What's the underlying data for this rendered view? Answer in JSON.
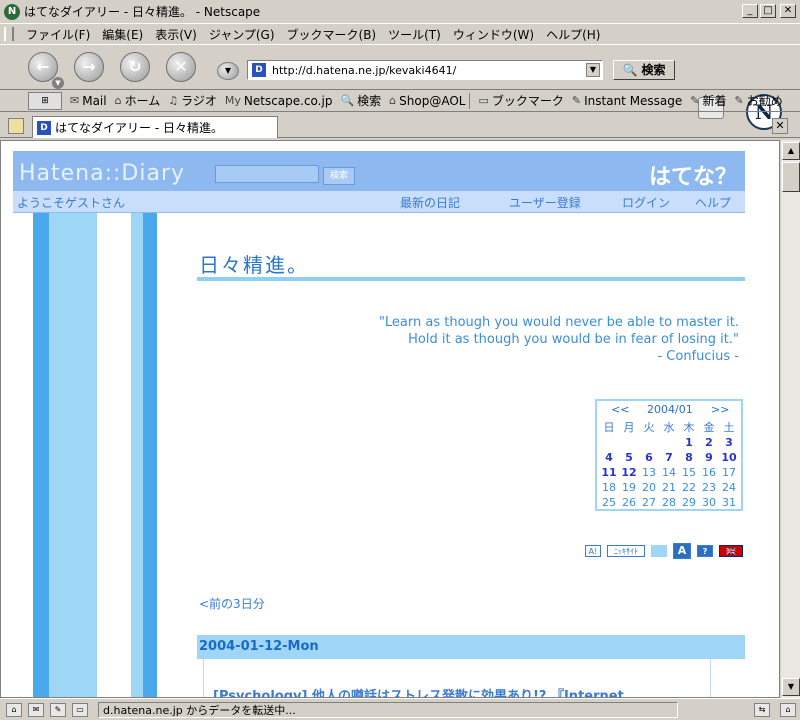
{
  "window": {
    "title": "はてなダイアリー - 日々精進。 - Netscape",
    "app_icon": "N",
    "minimize": "_",
    "maximize": "□",
    "close": "✕"
  },
  "menu": [
    "ファイル(F)",
    "編集(E)",
    "表示(V)",
    "ジャンプ(G)",
    "ブックマーク(B)",
    "ツール(T)",
    "ウィンドウ(W)",
    "ヘルプ(H)"
  ],
  "nav": {
    "url": "http://d.hatena.ne.jp/kevaki4641/",
    "search_label": "🔍 検索",
    "logo_letter": "N"
  },
  "personal_toolbar": [
    {
      "icon": "✉",
      "label": "Mail"
    },
    {
      "icon": "⌂",
      "label": "ホーム"
    },
    {
      "icon": "♫",
      "label": "ラジオ"
    },
    {
      "icon": "My",
      "label": "Netscape.co.jp"
    },
    {
      "icon": "🔍",
      "label": "検索"
    },
    {
      "icon": "⌂",
      "label": "Shop@AOL"
    },
    {
      "icon": "▭",
      "label": "ブックマーク"
    },
    {
      "icon": "✎",
      "label": "Instant Message"
    },
    {
      "icon": "✎",
      "label": "新着"
    },
    {
      "icon": "✎",
      "label": "お勧め"
    }
  ],
  "tab": {
    "label": "はてなダイアリー - 日々精進。",
    "favicon": "D",
    "close": "✕"
  },
  "page": {
    "header": {
      "logo": "Hatena::Diary",
      "search_button": "検索",
      "hatena": "はてな？"
    },
    "subheader": {
      "welcome": "ようこそゲストさん",
      "links": [
        "最新の日記",
        "ユーザー登録",
        "ログイン",
        "ヘルプ"
      ]
    },
    "diary_title": "日々精進。",
    "quote": {
      "line1": "\"Learn as though you would never be able to master it.",
      "line2": "Hold it as though you would be in fear of losing it.\"",
      "line3": "- Confucius -"
    },
    "calendar": {
      "prev": "<<",
      "month": "2004/01",
      "next": ">>",
      "dows": [
        "日",
        "月",
        "火",
        "水",
        "木",
        "金",
        "土"
      ],
      "weeks": [
        [
          "",
          "",
          "",
          "",
          "1",
          "2",
          "3"
        ],
        [
          "4",
          "5",
          "6",
          "7",
          "8",
          "9",
          "10"
        ],
        [
          "11",
          "12",
          "13",
          "14",
          "15",
          "16",
          "17"
        ],
        [
          "18",
          "19",
          "20",
          "21",
          "22",
          "23",
          "24"
        ],
        [
          "25",
          "26",
          "27",
          "28",
          "29",
          "30",
          "31"
        ]
      ],
      "bold_days": [
        "1",
        "2",
        "3",
        "4",
        "5",
        "6",
        "7",
        "8",
        "9",
        "10",
        "11",
        "12"
      ]
    },
    "badges": [
      "A!",
      "ﾆｯｷｻｲﾄ",
      "",
      "A",
      "?",
      "🇬🇧"
    ],
    "prev_link": "<前の3日分",
    "entry_date": "2004-01-12-Mon",
    "entry_title": "[Psychology] 他人の噂話はストレス発散に効果あり!? 『Internet"
  },
  "status": {
    "text": "d.hatena.ne.jp からデータを転送中..."
  }
}
